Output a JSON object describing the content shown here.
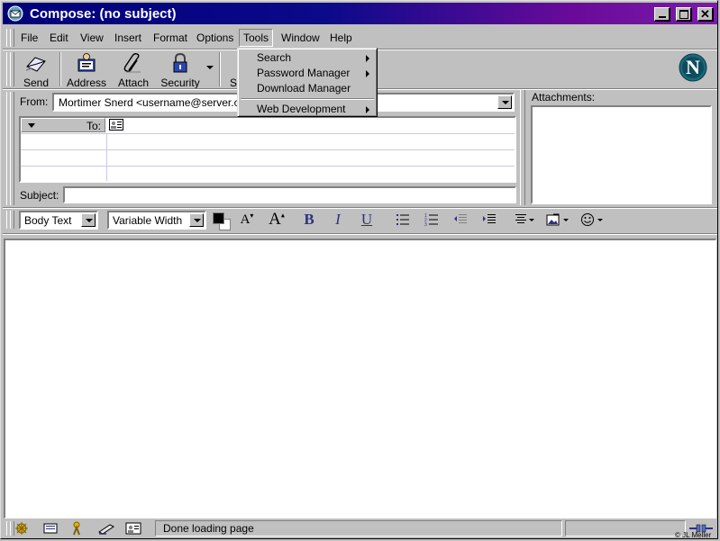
{
  "window": {
    "title": "Compose: (no subject)"
  },
  "menu": {
    "items": [
      "File",
      "Edit",
      "View",
      "Insert",
      "Format",
      "Options",
      "Tools",
      "Window",
      "Help"
    ],
    "open": "Tools"
  },
  "tools_menu": {
    "items": [
      "Search",
      "Password Manager",
      "Download Manager",
      "Web Development"
    ]
  },
  "toolbar": {
    "send": "Send",
    "address": "Address",
    "attach": "Attach",
    "security": "Security",
    "spell_partial": "S"
  },
  "header": {
    "from_label": "From:",
    "from_value": "Mortimer Snerd <username@server.com>",
    "to_label": "To:",
    "subject_label": "Subject:",
    "subject_value": "",
    "attachments_label": "Attachments:"
  },
  "format_bar": {
    "paragraph_style": "Body Text",
    "font": "Variable Width"
  },
  "status": {
    "text": "Done loading page",
    "watermark": "© JL Meller"
  }
}
